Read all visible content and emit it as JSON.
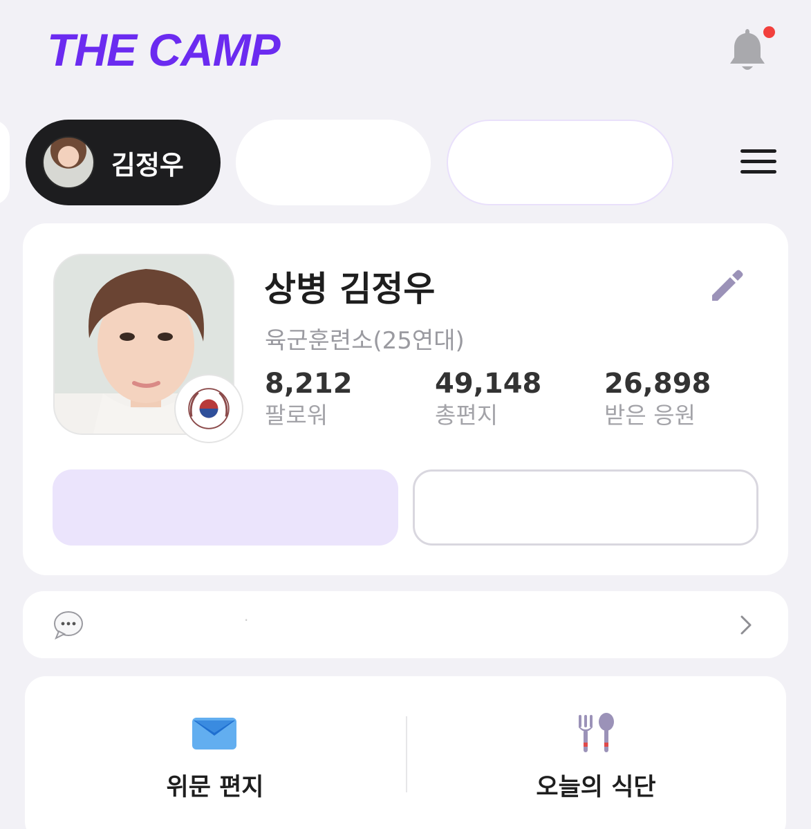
{
  "header": {
    "logo_text": "THE CAMP",
    "brand_color": "#6b2bf0",
    "notification_icon": "bell-icon",
    "notification_dot": true
  },
  "chips": {
    "active_name": "김정우",
    "menu_icon": "hamburger-menu-icon"
  },
  "profile": {
    "title": "상병 김정우",
    "unit": "육군훈련소(25연대)",
    "edit_icon": "pencil-icon",
    "stats": [
      {
        "value": "8,212",
        "label": "팔로워"
      },
      {
        "value": "49,148",
        "label": "총편지"
      },
      {
        "value": "26,898",
        "label": "받은 응원"
      }
    ]
  },
  "message_bar": {
    "icon": "speech-bubble-icon",
    "text": "·",
    "arrow_icon": "chevron-right-icon"
  },
  "bottom_menu": [
    {
      "label": "위문 편지",
      "icon": "envelope-icon"
    },
    {
      "label": "오늘의 식단",
      "icon": "fork-spoon-icon"
    }
  ]
}
